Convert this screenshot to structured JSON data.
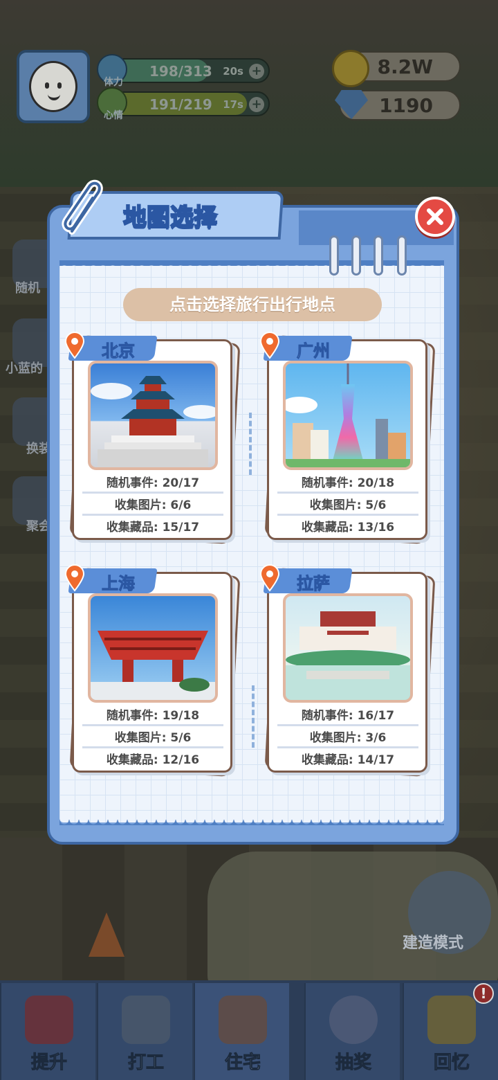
{
  "hud": {
    "stamina": {
      "label": "体力",
      "value": "198/313",
      "timer": "20s",
      "fill": 0.63
    },
    "mood": {
      "label": "心情",
      "value": "191/219",
      "timer": "17s",
      "fill": 0.87
    },
    "coins": "8.2W",
    "gems": "1190"
  },
  "side_buttons": [
    "随机",
    "小蓝的",
    "换装",
    "聚会"
  ],
  "build_mode": "建造模式",
  "modal": {
    "title": "地图选择",
    "subtitle": "点击选择旅行出行地点",
    "cities": [
      {
        "name": "北京",
        "rows": [
          "随机事件: 20/17",
          "收集图片: 6/6",
          "收集藏品: 15/17"
        ]
      },
      {
        "name": "广州",
        "rows": [
          "随机事件: 20/18",
          "收集图片: 5/6",
          "收集藏品: 13/16"
        ]
      },
      {
        "name": "上海",
        "rows": [
          "随机事件: 19/18",
          "收集图片: 5/6",
          "收集藏品: 12/16"
        ]
      },
      {
        "name": "拉萨",
        "rows": [
          "随机事件: 16/17",
          "收集图片: 3/6",
          "收集藏品: 14/17"
        ]
      }
    ]
  },
  "nav": [
    {
      "label": "提升",
      "icon": "book-icon"
    },
    {
      "label": "打工",
      "icon": "tv-icon"
    },
    {
      "label": "住宅",
      "icon": "house-icon"
    },
    {
      "label": "抽奖",
      "icon": "gashapon-icon"
    },
    {
      "label": "回忆",
      "icon": "camera-icon"
    }
  ],
  "nav_badge": "!",
  "colors": {
    "accent": "#5b8ed8",
    "close": "#e44a43",
    "modal_frame": "#7ba4dd",
    "subtitle_pill": "#dcc0a6"
  }
}
